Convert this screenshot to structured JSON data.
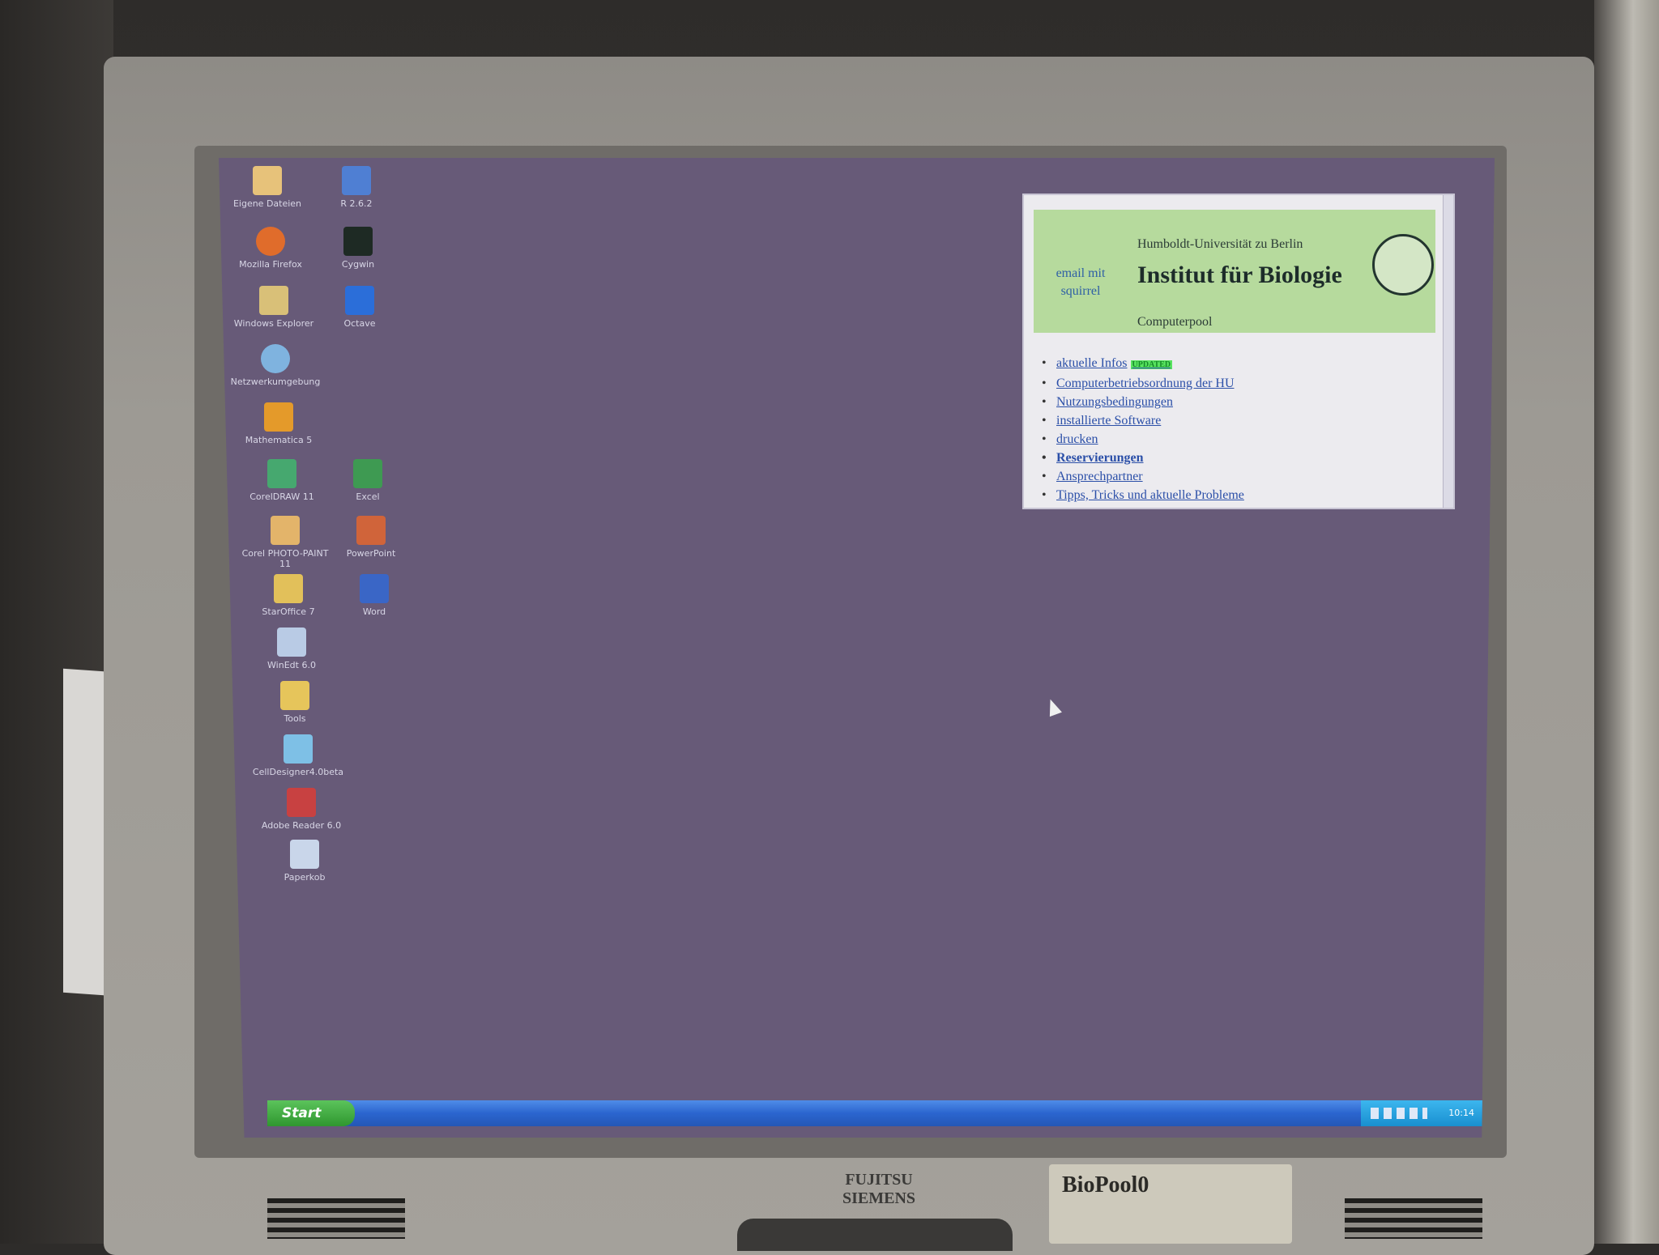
{
  "desktop": {
    "icons": [
      {
        "label": "Eigene Dateien",
        "color": "#e7c27a"
      },
      {
        "label": "R 2.6.2",
        "color": "#4f7fd3"
      },
      {
        "label": "Mozilla Firefox",
        "color": "#e06c2b"
      },
      {
        "label": "Cygwin",
        "color": "#1e2a24"
      },
      {
        "label": "Windows Explorer",
        "color": "#d9c078"
      },
      {
        "label": "Octave",
        "color": "#2b6ed9"
      },
      {
        "label": "Netzwerkumgebung",
        "color": "#7fb3df"
      },
      {
        "label": "Mathematica 5",
        "color": "#e49a2a"
      },
      {
        "label": "CorelDRAW 11",
        "color": "#46a86f"
      },
      {
        "label": "Excel",
        "color": "#3e9a52"
      },
      {
        "label": "Corel PHOTO-PAINT 11",
        "color": "#e3b46a"
      },
      {
        "label": "PowerPoint",
        "color": "#d0643a"
      },
      {
        "label": "StarOffice 7",
        "color": "#e2c05a"
      },
      {
        "label": "Word",
        "color": "#3a66c6"
      },
      {
        "label": "WinEdt 6.0",
        "color": "#b9cbe5"
      },
      {
        "label": "Tools",
        "color": "#e6c55b"
      },
      {
        "label": "CellDesigner4.0beta",
        "color": "#7ec0e6"
      },
      {
        "label": "Adobe Reader 6.0",
        "color": "#c84141"
      },
      {
        "label": "Paperkob",
        "color": "#c9d6ea"
      }
    ]
  },
  "browser": {
    "email": "email mit squirrel",
    "university": "Humboldt-Universität zu Berlin",
    "institute": "Institut für Biologie",
    "pool": "Computerpool",
    "badge": "UPDATED",
    "links": [
      "aktuelle Infos",
      "Computerbetriebsordnung der HU",
      "Nutzungsbedingungen",
      "installierte Software",
      "drucken",
      "Reservierungen",
      "Ansprechpartner",
      "Tipps, Tricks und aktuelle Probleme"
    ]
  },
  "taskbar": {
    "start_label": "Start",
    "clock": "10:14"
  },
  "monitor": {
    "brand_top": "FUJITSU",
    "brand_bottom": "SIEMENS",
    "sticker": "BioPool0"
  }
}
